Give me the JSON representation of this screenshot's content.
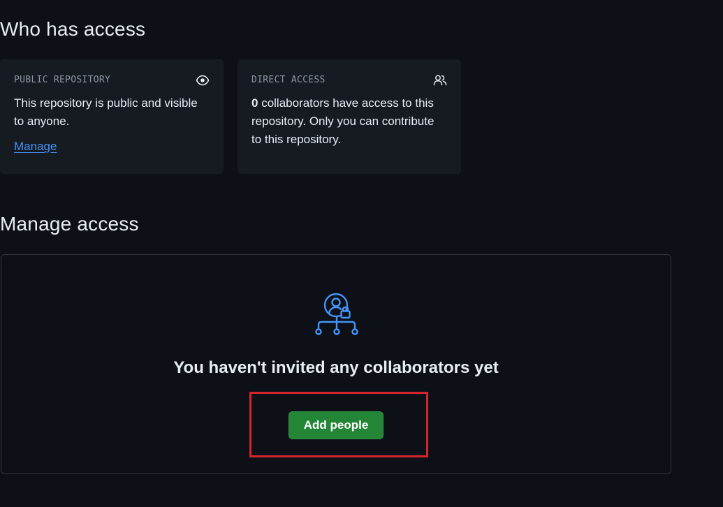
{
  "who_has_access": {
    "title": "Who has access",
    "public_card": {
      "label": "PUBLIC REPOSITORY",
      "icon": "eye-icon",
      "text": "This repository is public and visible to anyone.",
      "link": "Manage"
    },
    "direct_card": {
      "label": "DIRECT ACCESS",
      "icon": "people-icon",
      "count": "0",
      "text": " collaborators have access to this repository. Only you can contribute to this repository."
    }
  },
  "manage_access": {
    "title": "Manage access",
    "blankslate": {
      "icon": "person-lock-network-icon",
      "title": "You haven't invited any collaborators yet",
      "button_label": "Add people"
    }
  },
  "colors": {
    "background": "#0d1117",
    "card_background": "#161b22",
    "link": "#4493f8",
    "button_primary": "#238636",
    "highlight": "#d3252b"
  }
}
